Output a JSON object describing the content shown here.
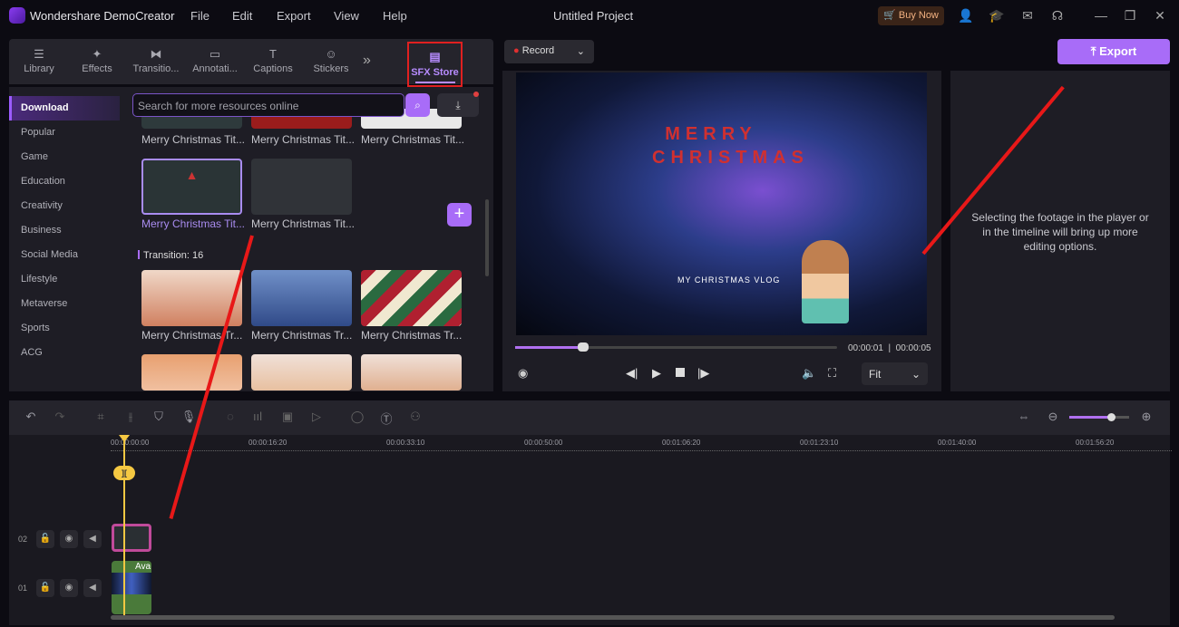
{
  "app": {
    "name": "Wondershare DemoCreator",
    "project": "Untitled Project",
    "menu": [
      "File",
      "Edit",
      "Export",
      "View",
      "Help"
    ],
    "buy_now": "Buy Now"
  },
  "tabs": [
    {
      "label": "Library",
      "icon": "layers-icon"
    },
    {
      "label": "Effects",
      "icon": "sparkle-icon"
    },
    {
      "label": "Transitio...",
      "icon": "transition-icon"
    },
    {
      "label": "Annotati...",
      "icon": "annotation-icon"
    },
    {
      "label": "Captions",
      "icon": "captions-icon"
    },
    {
      "label": "Stickers",
      "icon": "sticker-icon"
    }
  ],
  "sfx_tab": "SFX Store",
  "sidebar": [
    "Download",
    "Popular",
    "Game",
    "Education",
    "Creativity",
    "Business",
    "Social Media",
    "Lifestyle",
    "Metaverse",
    "Sports",
    "ACG"
  ],
  "search": {
    "placeholder": "Search for more resources online"
  },
  "titles": [
    "Merry Christmas Tit...",
    "Merry Christmas Tit...",
    "Merry Christmas Tit...",
    "Merry Christmas Tit...",
    "Merry Christmas Tit..."
  ],
  "transition_header": "Transition: 16",
  "transitions": [
    "Merry Christmas Tr...",
    "Merry Christmas Tr...",
    "Merry Christmas Tr..."
  ],
  "record": "Record",
  "export": "Export",
  "player": {
    "current": "00:00:01",
    "total": "00:00:05",
    "progress": 0.21,
    "fit": "Fit",
    "video_title": "MERRY CHRISTMAS",
    "video_sub": "MY CHRISTMAS  VLOG"
  },
  "info": "Selecting the footage in the player or in the timeline will bring up more editing options.",
  "timeline": {
    "ticks": [
      "00:00:00:00",
      "00:00:16:20",
      "00:00:33:10",
      "00:00:50:00",
      "00:01:06:20",
      "00:01:23:10",
      "00:01:40:00",
      "00:01:56:20"
    ],
    "tracks": [
      "02",
      "01"
    ],
    "clip_label": "Ava",
    "zoom": 0.7
  },
  "colors": {
    "accent": "#a86cf8",
    "annotation": "#e81818",
    "playhead": "#f5c842"
  }
}
